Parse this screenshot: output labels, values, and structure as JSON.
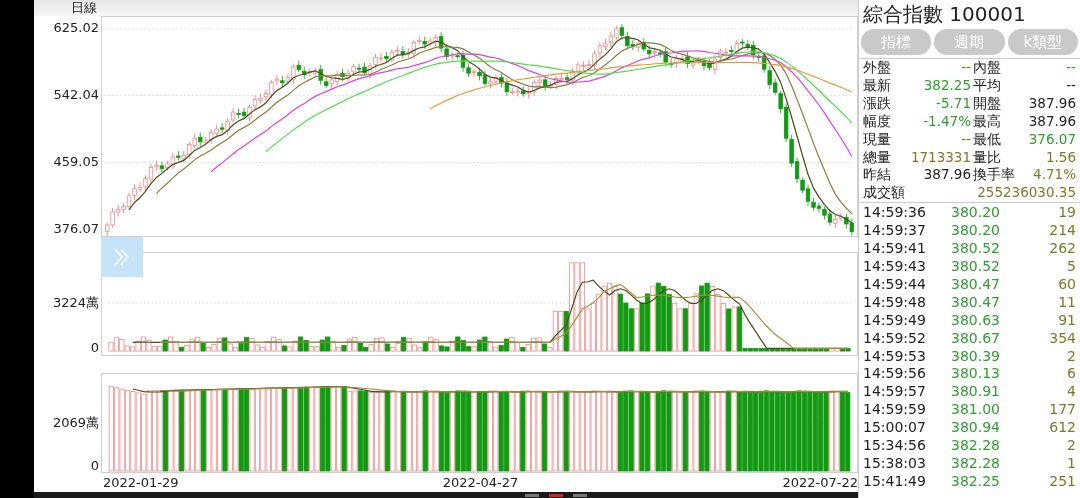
{
  "chart": {
    "period_label": "日線",
    "price_axis": [
      "625.02",
      "542.04",
      "459.05",
      "376.07"
    ],
    "volume_axis": [
      "3224萬",
      "0"
    ],
    "lower_axis": [
      "2069萬",
      "0"
    ],
    "dates": [
      "2022-01-29",
      "2022-04-27",
      "2022-07-22"
    ]
  },
  "quote": {
    "title": "綜合指數 100001",
    "buttons": [
      "指標",
      "週期",
      "k類型"
    ],
    "stats": [
      [
        {
          "label": "外盤",
          "value": "--",
          "color": "#7c7a2a"
        },
        {
          "label": "內盤",
          "value": "--",
          "color": "#2e9e2e"
        }
      ],
      [
        {
          "label": "最新",
          "value": "382.25",
          "color": "#2e9e2e"
        },
        {
          "label": "平均",
          "value": "--",
          "color": "#222222"
        }
      ],
      [
        {
          "label": "漲跌",
          "value": "-5.71",
          "color": "#2e9e2e"
        },
        {
          "label": "開盤",
          "value": "387.96",
          "color": "#222222"
        }
      ],
      [
        {
          "label": "幅度",
          "value": "-1.47%",
          "color": "#2e9e2e"
        },
        {
          "label": "最高",
          "value": "387.96",
          "color": "#222222"
        }
      ],
      [
        {
          "label": "現量",
          "value": "--",
          "color": "#7c7a2a"
        },
        {
          "label": "最低",
          "value": "376.07",
          "color": "#2e9e2e"
        }
      ],
      [
        {
          "label": "總量",
          "value": "1713331",
          "color": "#7c7a2a"
        },
        {
          "label": "量比",
          "value": "1.56",
          "color": "#7c7a2a"
        }
      ],
      [
        {
          "label": "昨結",
          "value": "387.96",
          "color": "#222222"
        },
        {
          "label": "換手率",
          "value": "4.71%",
          "color": "#7c7a2a"
        }
      ]
    ],
    "turnover": {
      "label": "成交額",
      "value": "255236030.35",
      "color": "#7c7a2a"
    }
  },
  "trades": [
    {
      "time": "14:59:36",
      "price": "380.20",
      "volume": "19"
    },
    {
      "time": "14:59:37",
      "price": "380.20",
      "volume": "214"
    },
    {
      "time": "14:59:41",
      "price": "380.52",
      "volume": "262"
    },
    {
      "time": "14:59:43",
      "price": "380.52",
      "volume": "5"
    },
    {
      "time": "14:59:44",
      "price": "380.47",
      "volume": "60"
    },
    {
      "time": "14:59:48",
      "price": "380.47",
      "volume": "11"
    },
    {
      "time": "14:59:49",
      "price": "380.63",
      "volume": "91"
    },
    {
      "time": "14:59:52",
      "price": "380.67",
      "volume": "354"
    },
    {
      "time": "14:59:53",
      "price": "380.39",
      "volume": "2"
    },
    {
      "time": "14:59:56",
      "price": "380.13",
      "volume": "6"
    },
    {
      "time": "14:59:57",
      "price": "380.91",
      "volume": "4"
    },
    {
      "time": "14:59:59",
      "price": "381.00",
      "volume": "177"
    },
    {
      "time": "15:00:07",
      "price": "380.94",
      "volume": "612"
    },
    {
      "time": "15:34:56",
      "price": "382.28",
      "volume": "2"
    },
    {
      "time": "15:38:03",
      "price": "382.28",
      "volume": "1"
    },
    {
      "time": "15:41:49",
      "price": "382.25",
      "volume": "251"
    }
  ],
  "pages": [
    {
      "selected": false
    },
    {
      "selected": true
    },
    {
      "selected": false
    }
  ]
}
